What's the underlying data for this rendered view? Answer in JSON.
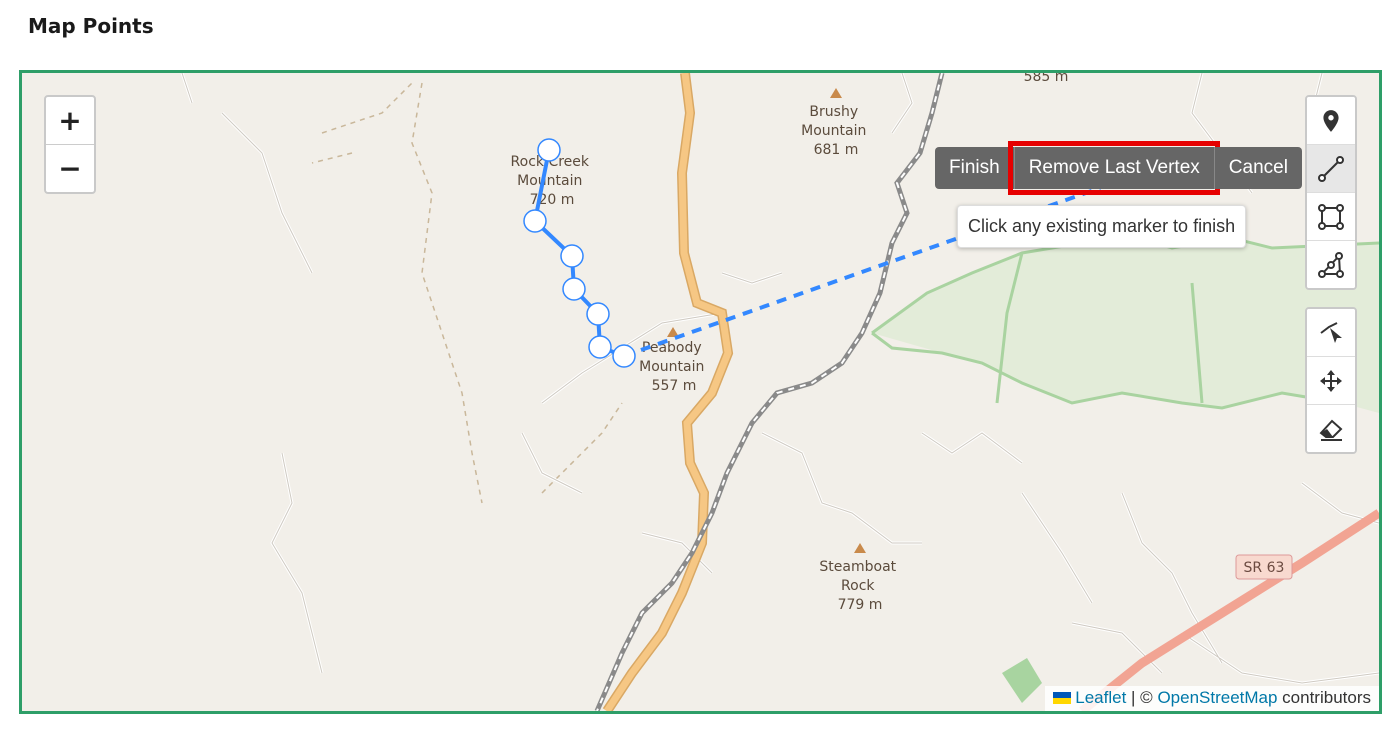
{
  "page": {
    "title": "Map Points"
  },
  "zoom": {
    "in_label": "+",
    "out_label": "−"
  },
  "draw_toolbar": {
    "tools": [
      {
        "name": "marker-icon",
        "active": false
      },
      {
        "name": "polyline-icon",
        "active": true
      },
      {
        "name": "rectangle-icon",
        "active": false
      },
      {
        "name": "polygon-icon",
        "active": false
      }
    ],
    "edit_tools": [
      {
        "name": "cut-icon"
      },
      {
        "name": "move-icon"
      },
      {
        "name": "eraser-icon"
      }
    ]
  },
  "actions": {
    "finish": "Finish",
    "remove_last_vertex": "Remove Last Vertex",
    "cancel": "Cancel"
  },
  "tooltip": {
    "text": "Click any existing marker to finish"
  },
  "map_labels": {
    "rock_creek": [
      "Rock Creek",
      "Mountain",
      "720 m"
    ],
    "brushy": [
      "Brushy",
      "Mountain",
      "681 m"
    ],
    "peabody": [
      "Peabody",
      "Mountain",
      "557 m"
    ],
    "steamboat": [
      "Steamboat",
      "Rock",
      "779 m"
    ],
    "top_partial": "585 m",
    "route_shield": "SR 63"
  },
  "attribution": {
    "leaflet": "Leaflet",
    "separator": " | © ",
    "osm": "OpenStreetMap",
    "contributors": " contributors"
  },
  "colors": {
    "map_bg": "#f2efe9",
    "frame": "#2e9e68",
    "draw_line": "#3388ff",
    "highway": "#f6c784",
    "state_route": "#f2a493",
    "railway": "#8a8a8a",
    "park_boundary": "#a9d3a0",
    "highlight": "#e60000"
  }
}
